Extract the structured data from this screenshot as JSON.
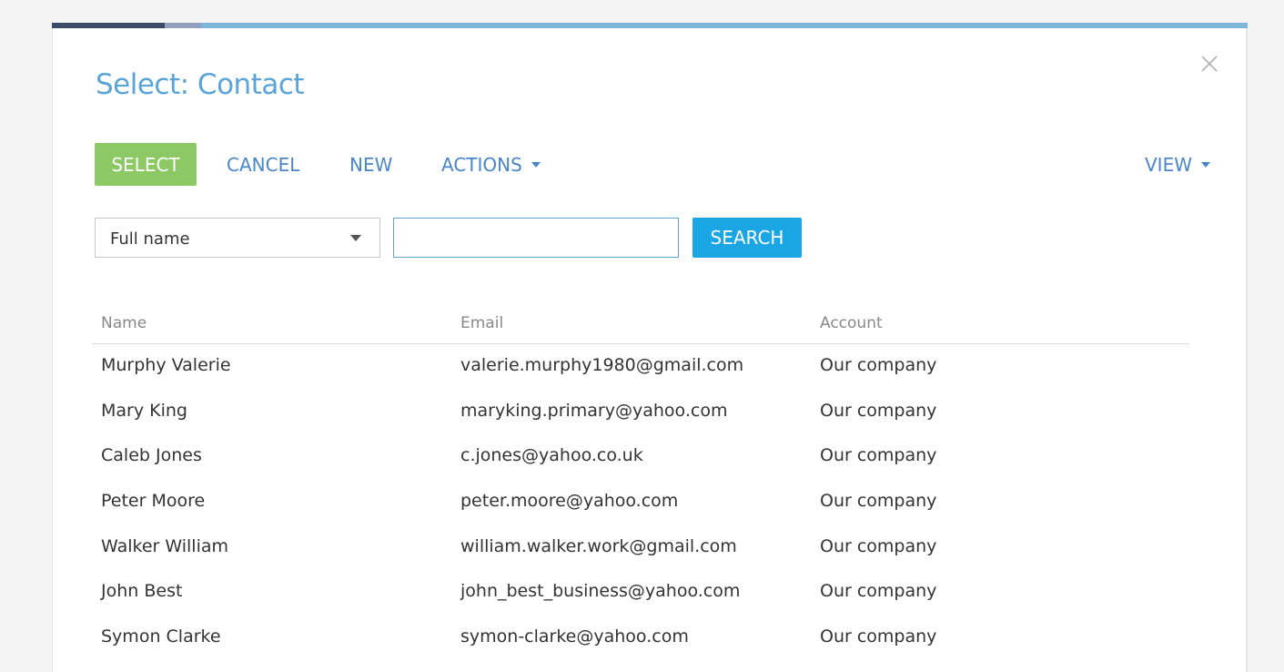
{
  "modal": {
    "title": "Select: Contact"
  },
  "toolbar": {
    "select_label": "SELECT",
    "cancel_label": "CANCEL",
    "new_label": "NEW",
    "actions_label": "ACTIONS",
    "view_label": "VIEW"
  },
  "filter": {
    "field_value": "Full name",
    "search_value": "",
    "search_button_label": "SEARCH"
  },
  "grid": {
    "columns": [
      "Name",
      "Email",
      "Account"
    ],
    "rows": [
      {
        "name": "Murphy Valerie",
        "email": "valerie.murphy1980@gmail.com",
        "account": "Our company"
      },
      {
        "name": "Mary King",
        "email": "maryking.primary@yahoo.com",
        "account": "Our company"
      },
      {
        "name": "Caleb Jones",
        "email": "c.jones@yahoo.co.uk",
        "account": "Our company"
      },
      {
        "name": "Peter Moore",
        "email": "peter.moore@yahoo.com",
        "account": "Our company"
      },
      {
        "name": "Walker William",
        "email": "william.walker.work@gmail.com",
        "account": "Our company"
      },
      {
        "name": "John Best",
        "email": "john_best_business@yahoo.com",
        "account": "Our company"
      },
      {
        "name": "Symon Clarke",
        "email": "symon-clarke@yahoo.com",
        "account": "Our company"
      }
    ]
  },
  "colors": {
    "accent": "#5aa4d8",
    "select_button": "#8cc864",
    "search_button": "#1aa6e4",
    "link": "#4a86c8"
  },
  "icons": {
    "close": "close-icon",
    "dropdown": "chevron-down-icon"
  }
}
